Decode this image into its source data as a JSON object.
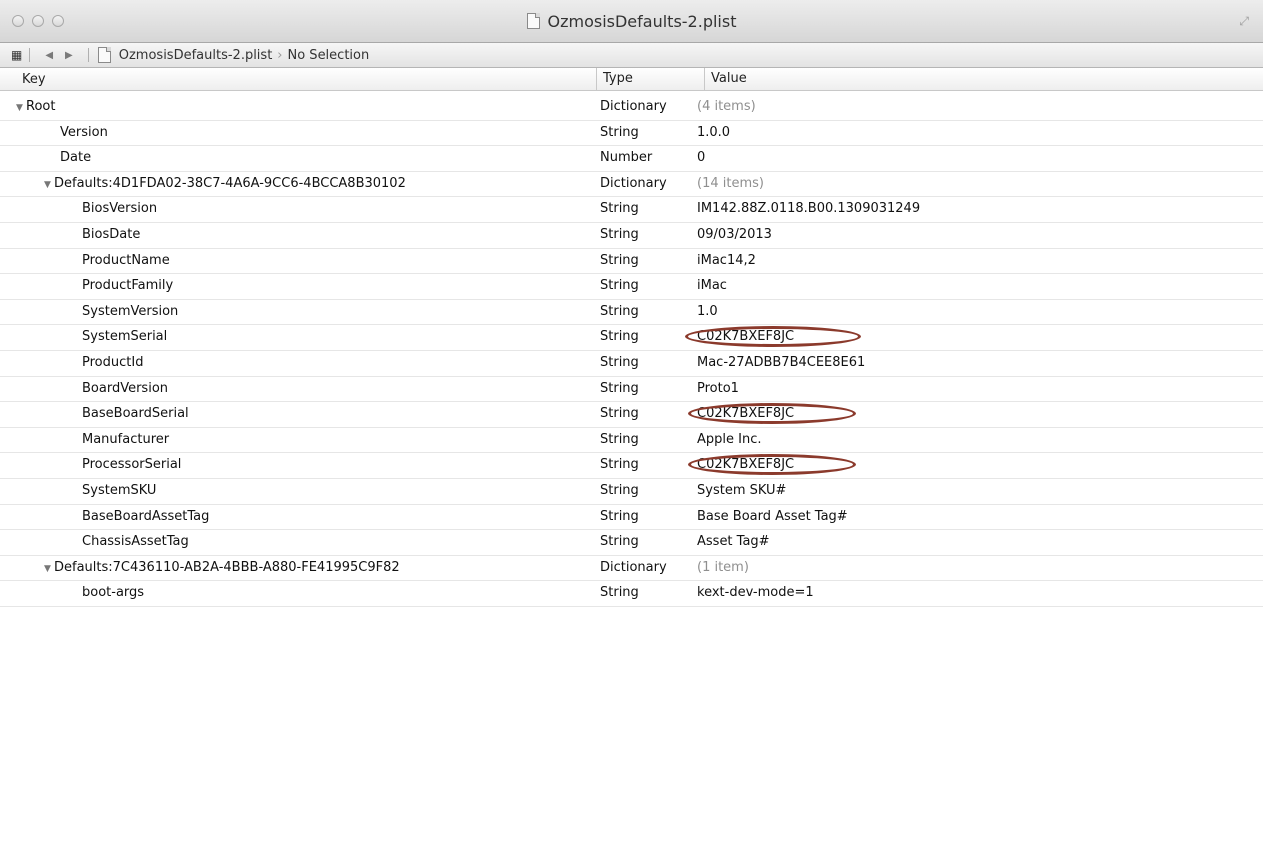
{
  "window": {
    "title": "OzmosisDefaults-2.plist",
    "resize_icon": "fullscreen-icon"
  },
  "pathbar": {
    "file": "OzmosisDefaults-2.plist",
    "selection": "No Selection"
  },
  "columns": {
    "key": "Key",
    "type": "Type",
    "value": "Value"
  },
  "rows": [
    {
      "key": "Root",
      "type": "Dictionary",
      "value": "(4 items)"
    },
    {
      "key": "Version",
      "type": "String",
      "value": "1.0.0"
    },
    {
      "key": "Date",
      "type": "Number",
      "value": "0"
    },
    {
      "key": "Defaults:4D1FDA02-38C7-4A6A-9CC6-4BCCA8B30102",
      "type": "Dictionary",
      "value": "(14 items)"
    },
    {
      "key": "BiosVersion",
      "type": "String",
      "value": "IM142.88Z.0118.B00.1309031249"
    },
    {
      "key": "BiosDate",
      "type": "String",
      "value": "09/03/2013"
    },
    {
      "key": "ProductName",
      "type": "String",
      "value": "iMac14,2"
    },
    {
      "key": "ProductFamily",
      "type": "String",
      "value": "iMac"
    },
    {
      "key": "SystemVersion",
      "type": "String",
      "value": "1.0"
    },
    {
      "key": "SystemSerial",
      "type": "String",
      "value": "C02K7BXEF8JC"
    },
    {
      "key": "ProductId",
      "type": "String",
      "value": "Mac-27ADBB7B4CEE8E61"
    },
    {
      "key": "BoardVersion",
      "type": "String",
      "value": "Proto1"
    },
    {
      "key": "BaseBoardSerial",
      "type": "String",
      "value": "C02K7BXEF8JC"
    },
    {
      "key": "Manufacturer",
      "type": "String",
      "value": "Apple Inc."
    },
    {
      "key": "ProcessorSerial",
      "type": "String",
      "value": "C02K7BXEF8JC"
    },
    {
      "key": "SystemSKU",
      "type": "String",
      "value": "System SKU#"
    },
    {
      "key": "BaseBoardAssetTag",
      "type": "String",
      "value": "Base Board Asset Tag#"
    },
    {
      "key": "ChassisAssetTag",
      "type": "String",
      "value": "Asset Tag#"
    },
    {
      "key": "Defaults:7C436110-AB2A-4BBB-A880-FE41995C9F82",
      "type": "Dictionary",
      "value": "(1 item)"
    },
    {
      "key": "boot-args",
      "type": "String",
      "value": "kext-dev-mode=1"
    }
  ],
  "annotation_color": "#8b3a2c"
}
